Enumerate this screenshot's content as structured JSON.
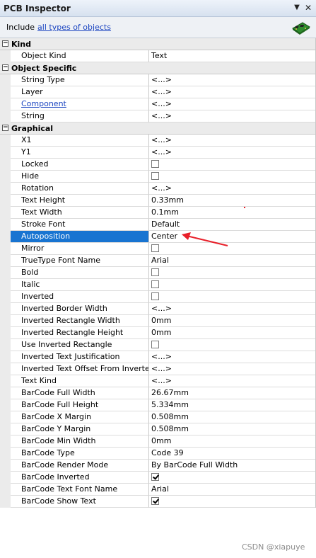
{
  "panel": {
    "title": "PCB Inspector"
  },
  "filter": {
    "prefix": "Include",
    "link": "all types of objects"
  },
  "categories": [
    {
      "label": "Kind",
      "toggle": "−",
      "rows": [
        {
          "name": "Object Kind",
          "value": "Text",
          "kind": "text"
        }
      ]
    },
    {
      "label": "Object Specific",
      "toggle": "−",
      "rows": [
        {
          "name": "String Type",
          "value": "<...>",
          "kind": "text"
        },
        {
          "name": "Layer",
          "value": "<...>",
          "kind": "text"
        },
        {
          "name": "Component",
          "value": "<...>",
          "kind": "text",
          "link": true
        },
        {
          "name": "String",
          "value": "<...>",
          "kind": "text"
        }
      ]
    },
    {
      "label": "Graphical",
      "toggle": "−",
      "rows": [
        {
          "name": "X1",
          "value": "<...>",
          "kind": "text"
        },
        {
          "name": "Y1",
          "value": "<...>",
          "kind": "text"
        },
        {
          "name": "Locked",
          "kind": "checkbox",
          "checked": false
        },
        {
          "name": "Hide",
          "kind": "checkbox",
          "checked": false
        },
        {
          "name": "Rotation",
          "value": "<...>",
          "kind": "text"
        },
        {
          "name": "Text Height",
          "value": "0.33mm",
          "kind": "text"
        },
        {
          "name": "Text Width",
          "value": "0.1mm",
          "kind": "text"
        },
        {
          "name": "Stroke Font",
          "value": "Default",
          "kind": "text"
        },
        {
          "name": "Autoposition",
          "value": "Center",
          "kind": "text",
          "selected": true
        },
        {
          "name": "Mirror",
          "kind": "checkbox",
          "checked": false
        },
        {
          "name": "TrueType Font Name",
          "value": "Arial",
          "kind": "text"
        },
        {
          "name": "Bold",
          "kind": "checkbox",
          "checked": false
        },
        {
          "name": "Italic",
          "kind": "checkbox",
          "checked": false
        },
        {
          "name": "Inverted",
          "kind": "checkbox",
          "checked": false
        },
        {
          "name": "Inverted Border Width",
          "value": "<...>",
          "kind": "text"
        },
        {
          "name": "Inverted Rectangle Width",
          "value": "0mm",
          "kind": "text"
        },
        {
          "name": "Inverted Rectangle Height",
          "value": "0mm",
          "kind": "text"
        },
        {
          "name": "Use Inverted Rectangle",
          "kind": "checkbox",
          "checked": false
        },
        {
          "name": "Inverted Text Justification",
          "value": "<...>",
          "kind": "text"
        },
        {
          "name": "Inverted Text Offset From Inverte...",
          "value": "<...>",
          "kind": "text"
        },
        {
          "name": "Text Kind",
          "value": "<...>",
          "kind": "text"
        },
        {
          "name": "BarCode Full Width",
          "value": "26.67mm",
          "kind": "text"
        },
        {
          "name": "BarCode Full Height",
          "value": "5.334mm",
          "kind": "text"
        },
        {
          "name": "BarCode X Margin",
          "value": "0.508mm",
          "kind": "text"
        },
        {
          "name": "BarCode Y Margin",
          "value": "0.508mm",
          "kind": "text"
        },
        {
          "name": "BarCode Min Width",
          "value": "0mm",
          "kind": "text"
        },
        {
          "name": "BarCode Type",
          "value": "Code 39",
          "kind": "text"
        },
        {
          "name": "BarCode Render Mode",
          "value": "By BarCode Full Width",
          "kind": "text"
        },
        {
          "name": "BarCode Inverted",
          "kind": "checkbox",
          "checked": true
        },
        {
          "name": "BarCode Text Font Name",
          "value": "Arial",
          "kind": "text"
        },
        {
          "name": "BarCode Show Text",
          "kind": "checkbox",
          "checked": true
        }
      ]
    }
  ],
  "watermark": "CSDN @xiapuye",
  "colors": {
    "selection": "#1874d1",
    "annotation_arrow": "#e8202a",
    "link": "#1a44c0"
  }
}
